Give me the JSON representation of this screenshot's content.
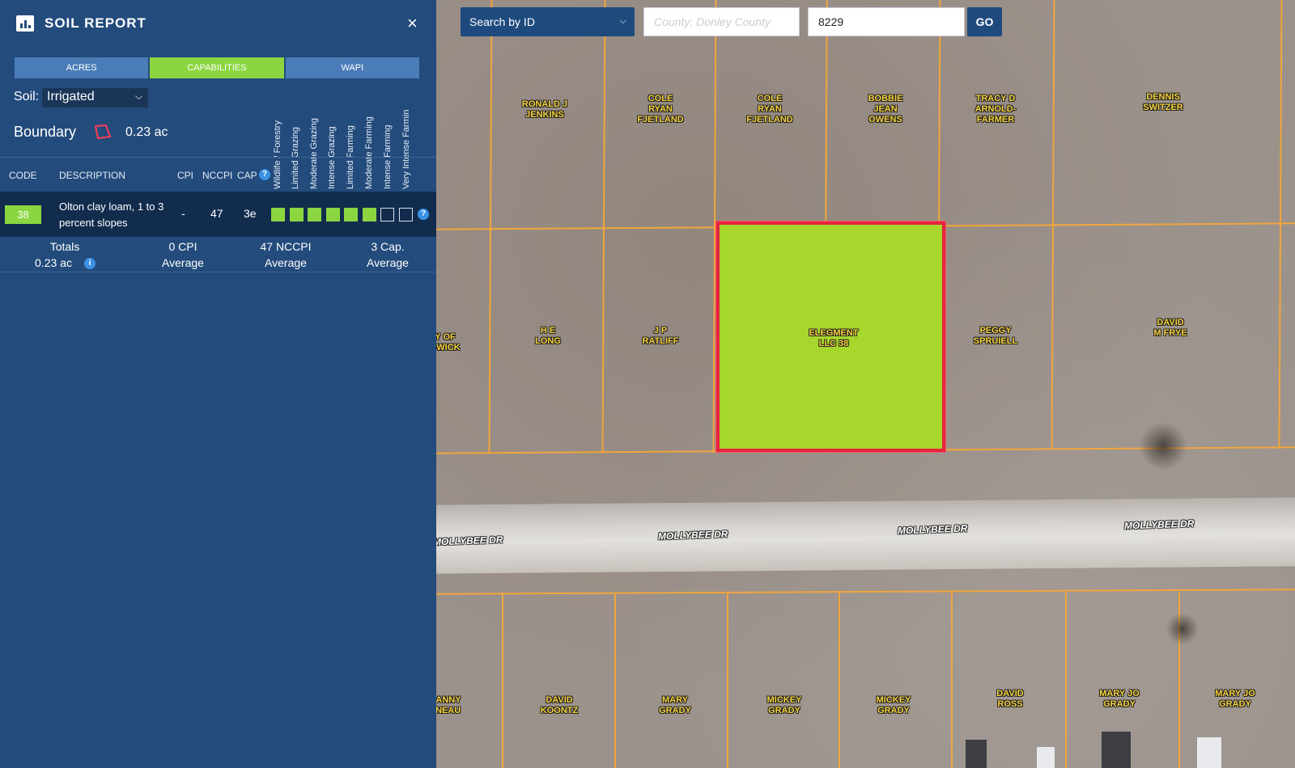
{
  "panel": {
    "title": "SOIL REPORT",
    "close_label": "×",
    "tabs": [
      "ACRES",
      "CAPABILITIES",
      "WAPI"
    ],
    "active_tab": "CAPABILITIES",
    "soil_label": "Soil:",
    "soil_value": "Irrigated",
    "boundary_label": "Boundary",
    "boundary_value": "0.23 ac",
    "capability_headers": [
      "Wildlife / Forestry",
      "Limited Grazing",
      "Moderate Grazing",
      "Intense Grazing",
      "Limited Farming",
      "Moderate Farming",
      "Intense Farming",
      "Very Intense Farmin"
    ],
    "columns": {
      "code": "CODE",
      "description": "DESCRIPTION",
      "cpi": "CPI",
      "nccpi": "NCCPI",
      "cap": "CAP"
    },
    "row": {
      "code": "38",
      "description": "Olton clay loam, 1 to 3 percent slopes",
      "cpi": "-",
      "nccpi": "47",
      "cap": "3e",
      "capability_fill": [
        true,
        true,
        true,
        true,
        true,
        true,
        false,
        false
      ]
    },
    "totals": {
      "label": "Totals",
      "acres": "0.23 ac",
      "cpi": "0 CPI",
      "cpi_sub": "Average",
      "nccpi": "47 NCCPI",
      "nccpi_sub": "Average",
      "cap": "3 Cap.",
      "cap_sub": "Average"
    },
    "accent_color": "#8bd640",
    "panel_color": "#234b7c"
  },
  "search": {
    "mode": "Search by ID",
    "county_placeholder": "County: Donley County",
    "id_value": "8229",
    "go_label": "GO"
  },
  "map": {
    "owners_top": [
      "RONALD J\nJENKINS",
      "COLE\nRYAN\nFJETLAND",
      "COLE\nRYAN\nFJETLAND",
      "BOBBIE\nJEAN\nOWENS",
      "TRACY D\nARNOLD-\nFARMER",
      "DENNIS\nSWITZER"
    ],
    "owners_mid": [
      "Y OF\nDWICK",
      "H E\nLONG",
      "J P\nRATLIFF",
      "PEGGY\nSPRUIELL",
      "DAVID\nM FRYE"
    ],
    "selected_owner": "ELEGMENT\nLLC 38",
    "owners_bottom": [
      "DANNY\nENEAU",
      "DAVID\nKOONTZ",
      "MARY\nGRADY",
      "MICKEY\nGRADY",
      "MICKEY\nGRADY",
      "DAVID\nROSS",
      "MARY JO\nGRADY",
      "MARY JO\nGRADY"
    ],
    "streets": [
      "MOLLYBEE DR",
      "MOLLYBEE DR",
      "MOLLYBEE DR",
      "MOLLYBEE DR"
    ],
    "selection_color": "#e3253c",
    "selection_fill": "#a7d62c"
  }
}
